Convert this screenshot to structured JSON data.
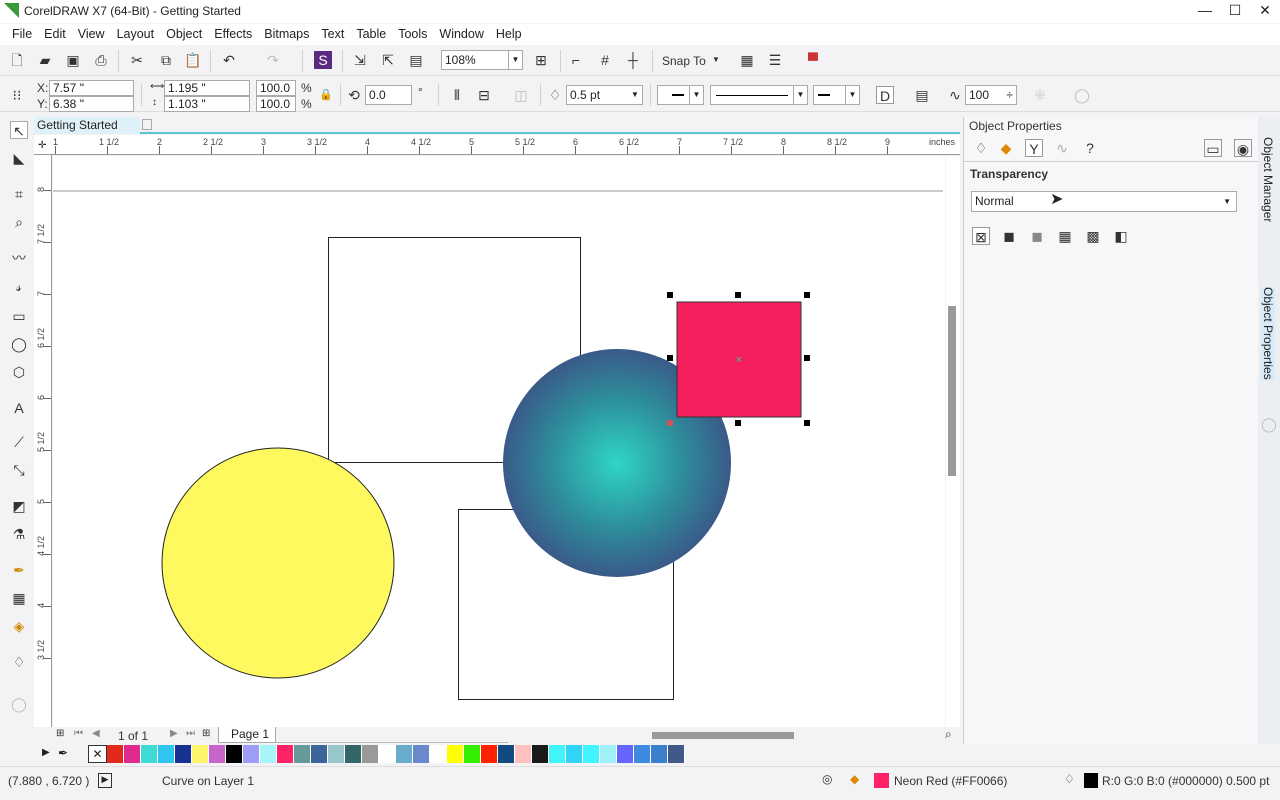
{
  "window": {
    "title": "CorelDRAW X7 (64-Bit) - Getting Started",
    "minimize": "—",
    "maximize": "☐",
    "close": "✕"
  },
  "menu": [
    "File",
    "Edit",
    "View",
    "Layout",
    "Object",
    "Effects",
    "Bitmaps",
    "Text",
    "Table",
    "Tools",
    "Window",
    "Help"
  ],
  "toolbar": {
    "zoom_level": "108%",
    "snap_to": "Snap To"
  },
  "property_bar": {
    "x": "7.57 \"",
    "y": "6.38 \"",
    "x_label": "X:",
    "y_label": "Y:",
    "width": "1.195 \"",
    "height": "1.103 \"",
    "scale_x": "100.0",
    "scale_y": "100.0",
    "pct": "%",
    "rotation": "0.0",
    "deg": "°",
    "outline_width": "0.5 pt",
    "smoothing": "100"
  },
  "document": {
    "tab": "Getting Started",
    "ruler_unit": "inches"
  },
  "ruler": {
    "top": [
      "1",
      "1 1/2",
      "2",
      "2 1/2",
      "3",
      "3 1/2",
      "4",
      "4 1/2",
      "5",
      "5 1/2",
      "6",
      "6 1/2",
      "7",
      "7 1/2",
      "8",
      "8 1/2",
      "9"
    ],
    "left": [
      "8",
      "7 1/2",
      "7",
      "6 1/2",
      "6",
      "5 1/2",
      "5",
      "4 1/2",
      "4",
      "3 1/2"
    ]
  },
  "page_nav": {
    "count": "1 of 1",
    "page_tab": "Page 1"
  },
  "docker": {
    "title": "Object Properties",
    "section": "Transparency",
    "mode": "Normal",
    "tabs": [
      "Object Manager",
      "Object Properties"
    ]
  },
  "palette": [
    "#e32a1a",
    "#e02a90",
    "#3ddbd4",
    "#30c5f0",
    "#17338f",
    "#fdf56a",
    "#c765c8",
    "#000000",
    "#9d9df5",
    "#a7f5f8",
    "#ff2266",
    "#669999",
    "#3a6699",
    "#99c6cc",
    "#336666",
    "#999999",
    "#ffffff",
    "#6aaccc",
    "#6a88cc",
    "#ffffff",
    "#ffff00",
    "#33ee00",
    "#ff2200",
    "#104a80",
    "#ffc0c0",
    "#1a1a1a",
    "#3ff5f8",
    "#30d5f5",
    "#40f5ff",
    "#a0f0f8",
    "#6666ff",
    "#3d8ae0",
    "#3a80cc",
    "#3f5a88"
  ],
  "status": {
    "cursor_pos": "(7.880 , 6.720 )",
    "selection": "Curve on Layer 1",
    "fill_label": "Neon Red (#FF0066)",
    "fill_color": "#FF2266",
    "outline_label": "R:0 G:0 B:0 (#000000) 0.500 pt",
    "outline_color": "#000000"
  }
}
